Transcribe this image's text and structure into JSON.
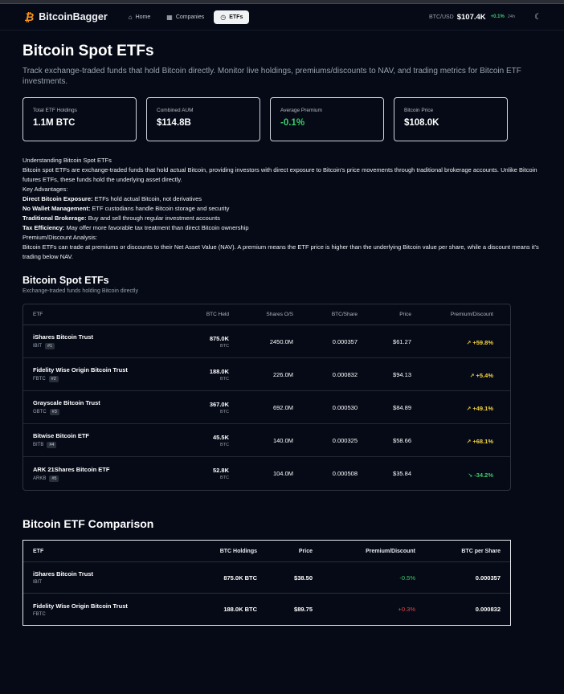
{
  "nav": {
    "brand": "BitcoinBagger",
    "items": [
      {
        "label": "Home",
        "icon": "home-icon",
        "glyph": "⌂",
        "active": false
      },
      {
        "label": "Companies",
        "icon": "building-icon",
        "glyph": "▦",
        "active": false
      },
      {
        "label": "ETFs",
        "icon": "etf-icon",
        "glyph": "◷",
        "active": true
      }
    ],
    "btc_label": "BTC/USD",
    "btc_price": "$107.4K",
    "btc_change": "+0.1%",
    "btc_period": "24h"
  },
  "page": {
    "title": "Bitcoin Spot ETFs",
    "subtitle": "Track exchange-traded funds that hold Bitcoin directly. Monitor live holdings, premiums/discounts to NAV, and trading metrics for Bitcoin ETF investments."
  },
  "stats": [
    {
      "label": "Total ETF Holdings",
      "value": "1.1M BTC"
    },
    {
      "label": "Combined AUM",
      "value": "$114.8B"
    },
    {
      "label": "Average Premium",
      "value": "-0.1%",
      "color": "#3ecb6b"
    },
    {
      "label": "Bitcoin Price",
      "value": "$108.0K"
    }
  ],
  "info": {
    "heading": "Understanding Bitcoin Spot ETFs",
    "intro": "Bitcoin spot ETFs are exchange-traded funds that hold actual Bitcoin, providing investors with direct exposure to Bitcoin's price movements through traditional brokerage accounts. Unlike Bitcoin futures ETFs, these funds hold the underlying asset directly.",
    "adv_heading": "Key Advantages:",
    "advantages": [
      {
        "term": "Direct Bitcoin Exposure:",
        "text": " ETFs hold actual Bitcoin, not derivatives"
      },
      {
        "term": "No Wallet Management:",
        "text": " ETF custodians handle Bitcoin storage and security"
      },
      {
        "term": "Traditional Brokerage:",
        "text": " Buy and sell through regular investment accounts"
      },
      {
        "term": "Tax Efficiency:",
        "text": " May offer more favorable tax treatment than direct Bitcoin ownership"
      }
    ],
    "prem_heading": "Premium/Discount Analysis:",
    "prem_text": "Bitcoin ETFs can trade at premiums or discounts to their Net Asset Value (NAV). A premium means the ETF price is higher than the underlying Bitcoin value per share, while a discount means it's trading below NAV."
  },
  "etf_section": {
    "title": "Bitcoin Spot ETFs",
    "subtitle": "Exchange-traded funds holding Bitcoin directly",
    "headers": {
      "etf": "ETF",
      "held": "BTC Held",
      "shares": "Shares O/S",
      "bps": "BTC/Share",
      "price": "Price",
      "premium": "Premium/Discount"
    },
    "rows": [
      {
        "name": "iShares Bitcoin Trust",
        "ticker": "IBIT",
        "rank": "#1",
        "held": "875.0K",
        "unit": "BTC",
        "shares": "2450.0M",
        "bps": "0.000357",
        "price": "$61.27",
        "premium": "+59.8%",
        "trend": "up"
      },
      {
        "name": "Fidelity Wise Origin Bitcoin Trust",
        "ticker": "FBTC",
        "rank": "#2",
        "held": "188.0K",
        "unit": "BTC",
        "shares": "226.0M",
        "bps": "0.000832",
        "price": "$94.13",
        "premium": "+5.4%",
        "trend": "up"
      },
      {
        "name": "Grayscale Bitcoin Trust",
        "ticker": "GBTC",
        "rank": "#3",
        "held": "367.0K",
        "unit": "BTC",
        "shares": "692.0M",
        "bps": "0.000530",
        "price": "$84.89",
        "premium": "+49.1%",
        "trend": "up"
      },
      {
        "name": "Bitwise Bitcoin ETF",
        "ticker": "BITB",
        "rank": "#4",
        "held": "45.5K",
        "unit": "BTC",
        "shares": "140.0M",
        "bps": "0.000325",
        "price": "$58.66",
        "premium": "+68.1%",
        "trend": "up"
      },
      {
        "name": "ARK 21Shares Bitcoin ETF",
        "ticker": "ARKB",
        "rank": "#5",
        "held": "52.8K",
        "unit": "BTC",
        "shares": "104.0M",
        "bps": "0.000508",
        "price": "$35.84",
        "premium": "-34.2%",
        "trend": "down"
      }
    ]
  },
  "comparison": {
    "title": "Bitcoin ETF Comparison",
    "headers": {
      "etf": "ETF",
      "holdings": "BTC Holdings",
      "price": "Price",
      "premium": "Premium/Discount",
      "bps": "BTC per Share"
    },
    "rows": [
      {
        "name": "iShares Bitcoin Trust",
        "ticker": "IBIT",
        "holdings": "875.0K BTC",
        "price": "$38.50",
        "premium": "-0.5%",
        "premium_color": "#3ecb6b",
        "bps": "0.000357"
      },
      {
        "name": "Fidelity Wise Origin Bitcoin Trust",
        "ticker": "FBTC",
        "holdings": "188.0K BTC",
        "price": "$89.75",
        "premium": "+0.3%",
        "premium_color": "#ef4444",
        "bps": "0.000832"
      }
    ]
  }
}
